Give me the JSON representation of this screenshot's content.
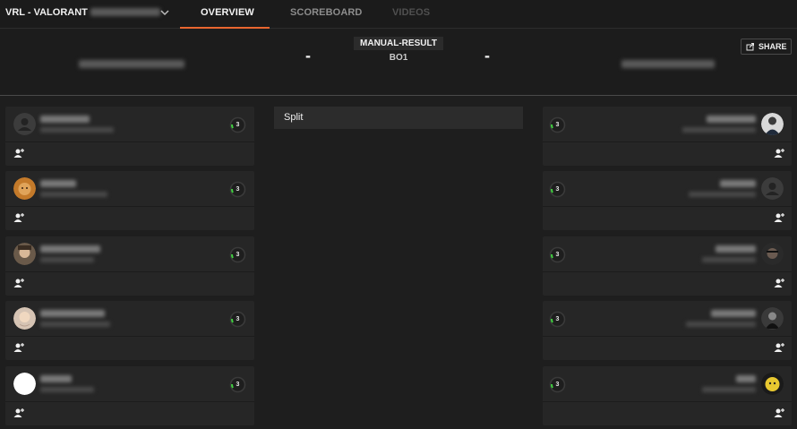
{
  "nav": {
    "event_title": "VRL - VALORANT",
    "tabs": [
      {
        "label": "OVERVIEW",
        "state": "active"
      },
      {
        "label": "SCOREBOARD",
        "state": "idle"
      },
      {
        "label": "VIDEOS",
        "state": "disabled"
      }
    ],
    "accent_color": "#e9662f"
  },
  "match": {
    "team_left_score": "-",
    "team_right_score": "-",
    "result_type": "MANUAL-RESULT",
    "format": "BO1",
    "share_label": "SHARE",
    "map": "Split"
  },
  "players_left": [
    {
      "level": "3",
      "avatar": "default-silhouette"
    },
    {
      "level": "3",
      "avatar": "lion"
    },
    {
      "level": "3",
      "avatar": "character"
    },
    {
      "level": "3",
      "avatar": "face"
    },
    {
      "level": "3",
      "avatar": "white-circle"
    }
  ],
  "players_right": [
    {
      "level": "3",
      "avatar": "suit"
    },
    {
      "level": "3",
      "avatar": "default-silhouette"
    },
    {
      "level": "3",
      "avatar": "dark-face"
    },
    {
      "level": "3",
      "avatar": "dark-figure"
    },
    {
      "level": "3",
      "avatar": "yellow-creature"
    }
  ],
  "icons": {
    "dropdown": "chevron-down-icon",
    "share": "share-icon",
    "add_friend": "add-friend-icon",
    "level_badge": "level-ring-icon"
  },
  "level_ring_color": "#3fd13f"
}
